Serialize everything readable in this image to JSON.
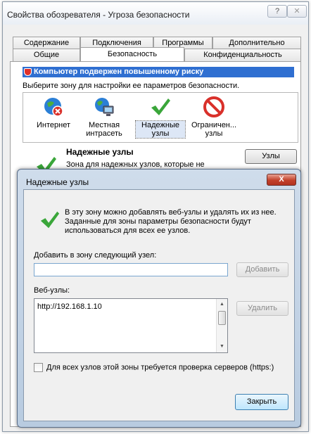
{
  "window": {
    "title": "Свойства обозревателя - Угроза безопасности",
    "help_label": "?",
    "close_label": "✕"
  },
  "tabs": {
    "row1": [
      "Содержание",
      "Подключения",
      "Программы",
      "Дополнительно"
    ],
    "row2": [
      "Общие",
      "Безопасность",
      "Конфиденциальность"
    ],
    "active": "Безопасность"
  },
  "security": {
    "risk_banner": "Компьютер подвержен повышенному риску",
    "zone_prompt": "Выберите зону для настройки ее параметров безопасности.",
    "zones": [
      {
        "label": "Интернет",
        "icon": "globe-warning-icon"
      },
      {
        "label": "Местная интрасеть",
        "icon": "intranet-icon"
      },
      {
        "label": "Надежные узлы",
        "icon": "checkmark-icon"
      },
      {
        "label": "Ограничен... узлы",
        "icon": "no-entry-icon"
      }
    ],
    "selected_zone": "Надежные узлы",
    "zone_title": "Надежные узлы",
    "zone_desc": "Зона для надежных узлов, которые не причинят вреда вашему компьютеру или",
    "sites_button": "Узлы"
  },
  "dialog": {
    "title": "Надежные узлы",
    "close_label": "X",
    "info_text": "В эту зону можно добавлять веб-узлы и удалять их из нее. Заданные для зоны параметры безопасности будут использоваться для всех ее узлов.",
    "add_label": "Добавить в зону следующий узел:",
    "add_input_value": "",
    "add_button": "Добавить",
    "sites_label": "Веб-узлы:",
    "sites": [
      "http://192.168.1.10"
    ],
    "remove_button": "Удалить",
    "https_label": "Для всех узлов этой зоны требуется проверка серверов (https:)",
    "https_checked": false,
    "close_button": "Закрыть"
  },
  "colors": {
    "risk_bar": "#2f6fd1",
    "check_green": "#3aa63a",
    "no_entry_red": "#d9302a",
    "dialog_frame": "#b8cbe0",
    "close_red": "#c2412b"
  }
}
